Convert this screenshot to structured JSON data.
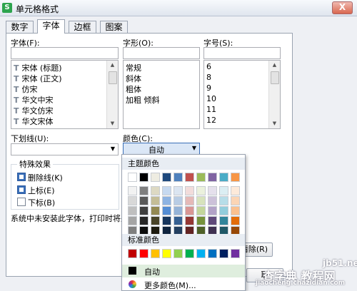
{
  "window": {
    "title": "单元格格式",
    "app_icon": "S",
    "close_symbol": "X"
  },
  "tabs": [
    "数字",
    "字体",
    "边框",
    "图案"
  ],
  "font": {
    "label": "字体(F):",
    "items": [
      "宋体 (标题)",
      "宋体 (正文)",
      "仿宋",
      "华文中宋",
      "华文仿宋",
      "华文宋体"
    ],
    "item_icon": "truetype-font-icon"
  },
  "style": {
    "label": "字形(O):",
    "items": [
      "常规",
      "斜体",
      "粗体",
      "加粗 倾斜"
    ]
  },
  "size": {
    "label": "字号(S):",
    "items": [
      "6",
      "8",
      "9",
      "10",
      "11",
      "12"
    ]
  },
  "underline": {
    "label": "下划线(U):",
    "value": ""
  },
  "color": {
    "label": "颜色(C):",
    "value": "自动"
  },
  "effects": {
    "title": "特殊效果",
    "items": [
      {
        "label": "删除线(K)",
        "checked": true
      },
      {
        "label": "上标(E)",
        "checked": true
      },
      {
        "label": "下标(B)",
        "checked": false
      }
    ]
  },
  "notice": "系统中未安装此字体，打印时将采",
  "buttons": {
    "clear": "清除(R)",
    "cancel": "取"
  },
  "palette": {
    "theme_label": "主题颜色",
    "theme_row": [
      "#ffffff",
      "#000000",
      "#eeece1",
      "#1f497d",
      "#4f81bd",
      "#c0504d",
      "#9bbb59",
      "#8064a2",
      "#4bacc6",
      "#f79646"
    ],
    "theme_shades": [
      [
        "#f2f2f2",
        "#7f7f7f",
        "#ddd9c3",
        "#c6d9f0",
        "#dbe5f1",
        "#f2dcdb",
        "#ebf1dd",
        "#e5e0ec",
        "#dbeef3",
        "#fdeada"
      ],
      [
        "#d8d8d8",
        "#595959",
        "#c4bd97",
        "#8db3e2",
        "#b8cce4",
        "#e5b9b7",
        "#d7e3bc",
        "#ccc1d9",
        "#b7dde8",
        "#fbd5b5"
      ],
      [
        "#bfbfbf",
        "#3f3f3f",
        "#938953",
        "#548dd4",
        "#95b3d7",
        "#d99694",
        "#c3d69b",
        "#b2a2c7",
        "#92cddc",
        "#fac08f"
      ],
      [
        "#a5a5a5",
        "#262626",
        "#494429",
        "#17365d",
        "#366092",
        "#953734",
        "#76923c",
        "#5f497a",
        "#31859b",
        "#e36c09"
      ],
      [
        "#7f7f7f",
        "#0c0c0c",
        "#1d1b10",
        "#0f243e",
        "#244061",
        "#632423",
        "#4f6128",
        "#3f3151",
        "#205867",
        "#974806"
      ]
    ],
    "standard_label": "标准颜色",
    "standard_row": [
      "#c00000",
      "#ff0000",
      "#ffc000",
      "#ffff00",
      "#92d050",
      "#00b050",
      "#00b0f0",
      "#0070c0",
      "#002060",
      "#7030a0"
    ],
    "auto_label": "自动",
    "more_label": "更多颜色(M)..."
  },
  "watermark": {
    "site": "jb51.net",
    "text": "查字典 教程网",
    "url": "jiaocheng.chazidian.com"
  }
}
